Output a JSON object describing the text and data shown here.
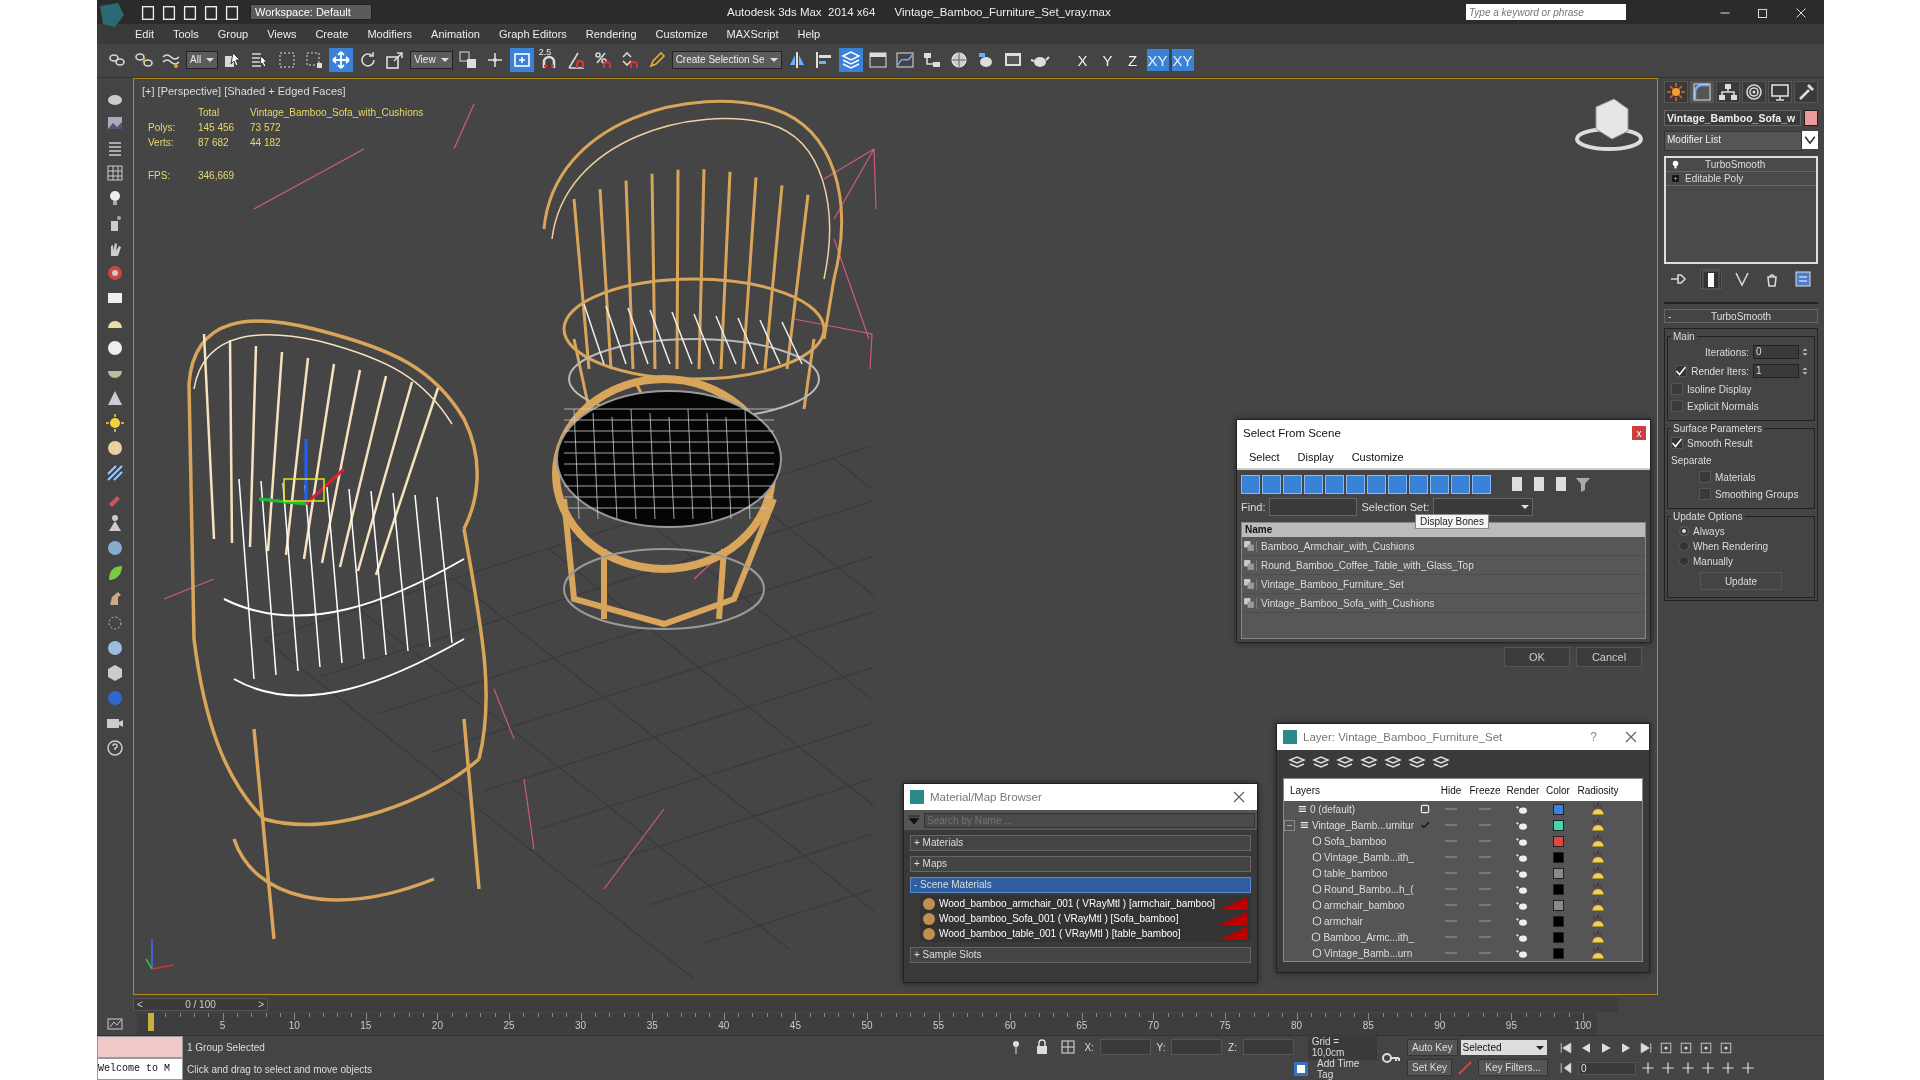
{
  "window": {
    "title": "Autodesk 3ds Max  2014 x64      Vintage_Bamboo_Furniture_Set_vray.max",
    "workspace": "Workspace: Default",
    "search_placeholder": "Type a keyword or phrase"
  },
  "menu": [
    "Edit",
    "Tools",
    "Group",
    "Views",
    "Create",
    "Modifiers",
    "Animation",
    "Graph Editors",
    "Rendering",
    "Customize",
    "MAXScript",
    "Help"
  ],
  "toolbar": {
    "tools": [
      {
        "kind": "link",
        "selected": false
      },
      {
        "kind": "unlink",
        "selected": false
      },
      {
        "kind": "bind",
        "selected": false
      },
      {
        "kind": "dropdown",
        "value": "All"
      },
      {
        "kind": "select",
        "selected": false
      },
      {
        "kind": "select_by_name",
        "selected": false
      },
      {
        "kind": "region",
        "selected": false
      },
      {
        "kind": "window_crossing",
        "selected": false
      },
      {
        "kind": "move",
        "selected": true
      },
      {
        "kind": "rotate",
        "selected": false
      },
      {
        "kind": "scale",
        "selected": false
      },
      {
        "kind": "dropdown",
        "value": "View"
      },
      {
        "kind": "pivot",
        "selected": false
      },
      {
        "kind": "manipulate",
        "selected": false
      },
      {
        "kind": "shortcut",
        "selected": true
      },
      {
        "kind": "snap",
        "label": "2.5",
        "selected": false
      },
      {
        "kind": "angle_snap",
        "selected": false
      },
      {
        "kind": "percent_snap",
        "selected": false
      },
      {
        "kind": "spinner_snap",
        "selected": false
      },
      {
        "kind": "named_sel",
        "selected": false
      },
      {
        "kind": "dropdown",
        "value": "Create Selection Se"
      },
      {
        "kind": "mirror",
        "selected": false
      },
      {
        "kind": "align",
        "selected": false
      },
      {
        "kind": "layers",
        "selected": true
      },
      {
        "kind": "ribbon",
        "selected": false
      },
      {
        "kind": "curve_editor",
        "selected": false
      },
      {
        "kind": "schematic",
        "selected": false
      },
      {
        "kind": "material_editor",
        "selected": false
      },
      {
        "kind": "render_setup",
        "selected": false
      },
      {
        "kind": "rendered_frame",
        "selected": false
      },
      {
        "kind": "render",
        "selected": false
      }
    ],
    "axis_buttons": [
      {
        "label": "X",
        "selected": false
      },
      {
        "label": "Y",
        "selected": false
      },
      {
        "label": "Z",
        "selected": false
      },
      {
        "label": "XY",
        "selected": true
      },
      {
        "label": "XY",
        "selected": true
      }
    ]
  },
  "viewport": {
    "label": "[+] [Perspective] [Shaded + Edged Faces]",
    "stats": {
      "header": [
        "Total",
        "Vintage_Bamboo_Sofa_with_Cushions"
      ],
      "rows": [
        {
          "label": "Polys:",
          "total": "145 456",
          "selected": "73 572"
        },
        {
          "label": "Verts:",
          "total": "87 682",
          "selected": "44 182"
        }
      ],
      "fps_label": "FPS:",
      "fps": "346,669"
    }
  },
  "command_panel": {
    "tabs": [
      {
        "kind": "create",
        "selected": false
      },
      {
        "kind": "modify",
        "selected": true
      },
      {
        "kind": "hierarchy",
        "selected": false
      },
      {
        "kind": "motion",
        "selected": false
      },
      {
        "kind": "display",
        "selected": false
      },
      {
        "kind": "utilities",
        "selected": false
      }
    ],
    "object_name": "Vintage_Bamboo_Sofa_w",
    "modifier_list": "Modifier List",
    "stack": [
      {
        "name": "TurboSmooth",
        "kind": "modifier"
      },
      {
        "name": "Editable Poly",
        "kind": "base"
      }
    ],
    "stack_tools": [
      {
        "kind": "pin",
        "selected": false
      },
      {
        "kind": "end_result",
        "selected": true
      },
      {
        "kind": "unique",
        "selected": false
      },
      {
        "kind": "remove",
        "selected": false
      },
      {
        "kind": "configure",
        "selected": false
      }
    ],
    "rollout": {
      "sign": "-",
      "title": "TurboSmooth",
      "groups": [
        {
          "title": "Main",
          "controls": [
            {
              "kind": "spinner",
              "label": "Iterations:",
              "value": "0"
            },
            {
              "kind": "check_spinner",
              "label": "Render Iters:",
              "checked": true,
              "value": "1"
            },
            {
              "kind": "checkbox",
              "label": "Isoline Display",
              "checked": false
            },
            {
              "kind": "checkbox",
              "label": "Explicit Normals",
              "checked": false
            }
          ]
        },
        {
          "title": "Surface Parameters",
          "controls": [
            {
              "kind": "checkbox",
              "label": "Smooth Result",
              "checked": true
            },
            {
              "kind": "label",
              "label": "Separate"
            },
            {
              "kind": "subcheckbox",
              "label": "Materials",
              "checked": false
            },
            {
              "kind": "subcheckbox",
              "label": "Smoothing Groups",
              "checked": false
            }
          ]
        },
        {
          "title": "Update Options",
          "controls": [
            {
              "kind": "radio",
              "label": "Always",
              "selected": true
            },
            {
              "kind": "radio",
              "label": "When Rendering",
              "selected": false
            },
            {
              "kind": "radio",
              "label": "Manually",
              "selected": false
            },
            {
              "kind": "button",
              "label": "Update"
            }
          ]
        }
      ]
    }
  },
  "select_dialog": {
    "title": "Select From Scene",
    "close": "x",
    "menu": [
      "Select",
      "Display",
      "Customize"
    ],
    "filters": [
      {
        "on": true
      },
      {
        "on": true
      },
      {
        "on": true
      },
      {
        "on": true
      },
      {
        "on": true
      },
      {
        "on": true
      },
      {
        "on": true
      },
      {
        "on": true
      },
      {
        "on": true
      },
      {
        "on": true
      },
      {
        "on": true
      },
      {
        "on": true
      }
    ],
    "find_label": "Find:",
    "selection_set_label": "Selection Set:",
    "tooltip": "Display Bones",
    "column": "Name",
    "rows": [
      "Bamboo_Armchair_with_Cushions",
      "Round_Bamboo_Coffee_Table_with_Glass_Top",
      "Vintage_Bamboo_Furniture_Set",
      "Vintage_Bamboo_Sofa_with_Cushions"
    ],
    "ok": "OK",
    "cancel": "Cancel"
  },
  "layer_dialog": {
    "title": "Layer: Vintage_Bamboo_Furniture_Set",
    "help": "?",
    "columns": [
      "Layers",
      "Hide",
      "Freeze",
      "Render",
      "Color",
      "Radiosity"
    ],
    "layers": [
      {
        "name": "0 (default)",
        "current": false,
        "color": "#3f7fe0"
      },
      {
        "name": "Vintage_Bamb...urnitur",
        "current": true,
        "expanded": true,
        "color": "#3fd6b0",
        "children": [
          {
            "name": "Sofa_bamboo",
            "color": "#e04848"
          },
          {
            "name": "Vintage_Bamb...ith_",
            "color": "#000000"
          },
          {
            "name": "table_bamboo",
            "color": "#8a8a8a"
          },
          {
            "name": "Round_Bambo...h_(",
            "color": "#000000"
          },
          {
            "name": "armchair_bamboo",
            "color": "#8a8a8a"
          },
          {
            "name": "armchair",
            "color": "#000000"
          },
          {
            "name": "Bamboo_Armc...ith_",
            "color": "#000000"
          },
          {
            "name": "Vintage_Bamb...urn",
            "color": "#000000"
          }
        ]
      }
    ]
  },
  "material_browser": {
    "title": "Material/Map Browser",
    "search_placeholder": "Search by Name ...",
    "groups": [
      {
        "label": "+ Materials",
        "expanded": false
      },
      {
        "label": "+ Maps",
        "expanded": false
      },
      {
        "label": "- Scene Materials",
        "expanded": true,
        "items": [
          "Wood_bamboo_armchair_001  ( VRayMtl ) [armchair_bamboo]",
          "Wood_bamboo_Sofa_001 ( VRayMtl ) [Sofa_bamboo]",
          "Wood_bamboo_table_001 ( VRayMtl ) [table_bamboo]"
        ]
      },
      {
        "label": "+ Sample Slots",
        "expanded": false
      }
    ]
  },
  "timeline": {
    "prev": "<",
    "frame": "0 / 100",
    "next": ">",
    "level": 0,
    "ticks": [
      "5",
      "10",
      "15",
      "20",
      "25",
      "30",
      "35",
      "40",
      "45",
      "50",
      "55",
      "60",
      "65",
      "70",
      "75",
      "80",
      "85",
      "90",
      "95",
      "100"
    ]
  },
  "status_bar": {
    "listener": "Welcome to M",
    "selection": "1 Group Selected",
    "prompt": "Click and drag to select and move objects",
    "x_label": "X:",
    "y_label": "Y:",
    "z_label": "Z:",
    "grid": "Grid = 10,0cm",
    "add_time_tag": "Add Time Tag",
    "auto_key": "Auto Key",
    "key_mode": "Selected",
    "set_key": "Set Key",
    "key_filters": "Key Filters...",
    "current_frame": "0"
  }
}
